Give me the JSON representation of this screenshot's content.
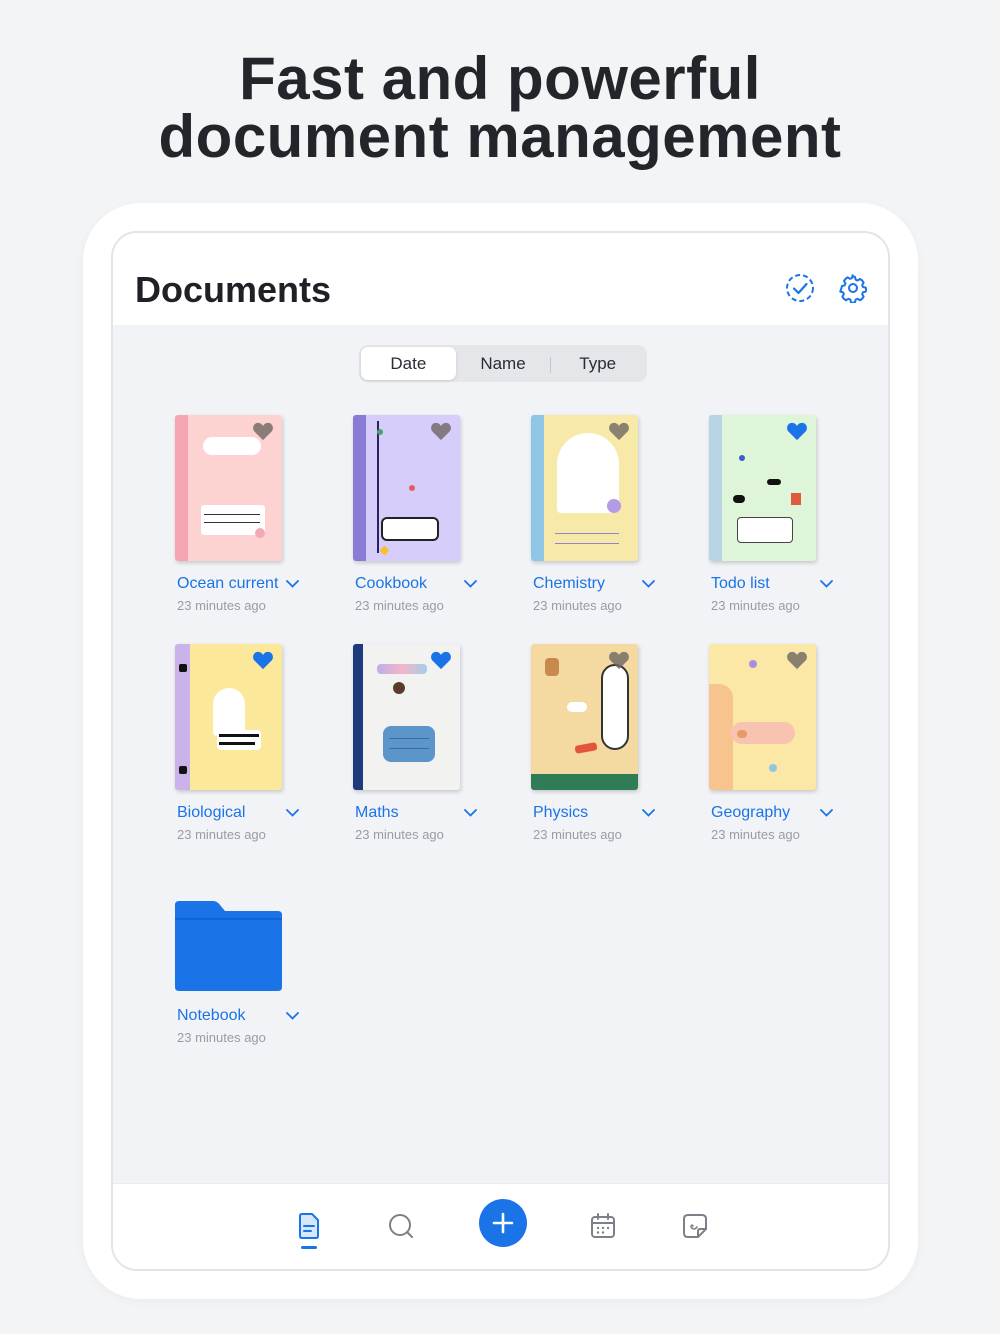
{
  "headline": {
    "line1": "Fast and powerful",
    "line2": "document management"
  },
  "topbar": {
    "title": "Documents",
    "select_icon": "check-circle-dashed-icon",
    "settings_icon": "gear-icon"
  },
  "sort": {
    "options": [
      "Date",
      "Name",
      "Type"
    ],
    "selected": "Date"
  },
  "documents": [
    {
      "name": "Ocean current",
      "time": "23 minutes ago",
      "favorite": false
    },
    {
      "name": "Cookbook",
      "time": "23 minutes ago",
      "favorite": false
    },
    {
      "name": "Chemistry",
      "time": "23 minutes ago",
      "favorite": false
    },
    {
      "name": "Todo list",
      "time": "23 minutes ago",
      "favorite": true
    },
    {
      "name": "Biological",
      "time": "23 minutes ago",
      "favorite": true
    },
    {
      "name": "Maths",
      "time": "23 minutes ago",
      "favorite": true
    },
    {
      "name": "Physics",
      "time": "23 minutes ago",
      "favorite": false
    },
    {
      "name": "Geography",
      "time": "23 minutes ago",
      "favorite": false
    }
  ],
  "folders": [
    {
      "name": "Notebook",
      "time": "23 minutes ago"
    }
  ],
  "tabbar": {
    "tabs": [
      "documents-icon",
      "search-icon",
      "add-icon",
      "calendar-icon",
      "sticker-icon"
    ],
    "active": "documents-icon"
  },
  "colors": {
    "accent": "#1a74e8",
    "heart_favorite": "#1a74e8",
    "heart_default": "#6e6660"
  }
}
